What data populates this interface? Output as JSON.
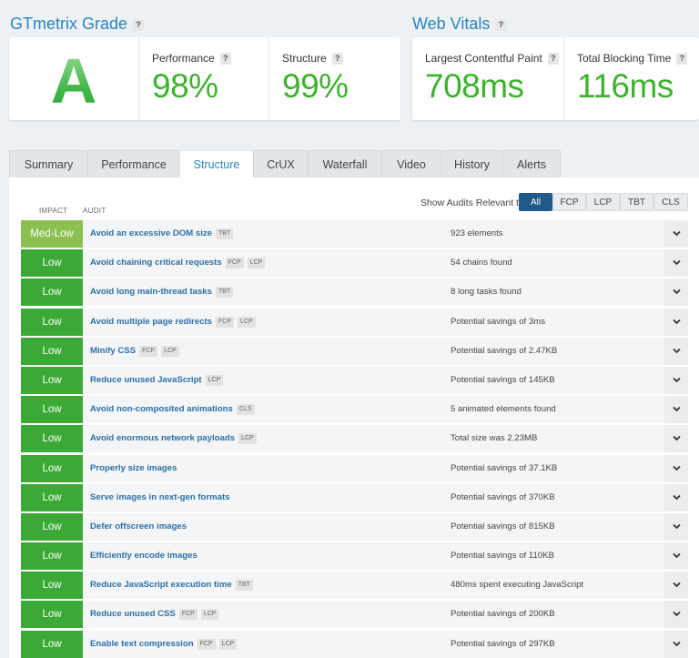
{
  "grade_section": {
    "title": "GTmetrix Grade",
    "help": "?",
    "grade": "A",
    "metrics": [
      {
        "label": "Performance",
        "value": "98%"
      },
      {
        "label": "Structure",
        "value": "99%"
      }
    ]
  },
  "vitals_section": {
    "title": "Web Vitals",
    "help": "?",
    "metrics": [
      {
        "label": "Largest Contentful Paint",
        "value": "708ms"
      },
      {
        "label": "Total Blocking Time",
        "value": "116ms"
      }
    ]
  },
  "tabs": [
    "Summary",
    "Performance",
    "Structure",
    "CrUX",
    "Waterfall",
    "Video",
    "History",
    "Alerts"
  ],
  "active_tab": "Structure",
  "table": {
    "impact_header": "IMPACT",
    "audit_header": "AUDIT",
    "filter_label": "Show Audits Relevant to",
    "filters": [
      "All",
      "FCP",
      "LCP",
      "TBT",
      "CLS"
    ],
    "active_filter": "All"
  },
  "colors": {
    "med_low": "#8cc152",
    "low": "#3aa935",
    "accent": "#2a84c2",
    "grade": "#4cbc52"
  },
  "audits": [
    {
      "impact": "Med-Low",
      "name": "Avoid an excessive DOM size",
      "tags": [
        "TBT"
      ],
      "result": "923 elements"
    },
    {
      "impact": "Low",
      "name": "Avoid chaining critical requests",
      "tags": [
        "FCP",
        "LCP"
      ],
      "result": "54 chains found"
    },
    {
      "impact": "Low",
      "name": "Avoid long main-thread tasks",
      "tags": [
        "TBT"
      ],
      "result": "8 long tasks found"
    },
    {
      "impact": "Low",
      "name": "Avoid multiple page redirects",
      "tags": [
        "FCP",
        "LCP"
      ],
      "result": "Potential savings of 3ms"
    },
    {
      "impact": "Low",
      "name": "Minify CSS",
      "tags": [
        "FCP",
        "LCP"
      ],
      "result": "Potential savings of 2.47KB"
    },
    {
      "impact": "Low",
      "name": "Reduce unused JavaScript",
      "tags": [
        "LCP"
      ],
      "result": "Potential savings of 145KB"
    },
    {
      "impact": "Low",
      "name": "Avoid non-composited animations",
      "tags": [
        "CLS"
      ],
      "result": "5 animated elements found"
    },
    {
      "impact": "Low",
      "name": "Avoid enormous network payloads",
      "tags": [
        "LCP"
      ],
      "result": "Total size was 2.23MB"
    },
    {
      "impact": "Low",
      "name": "Properly size images",
      "tags": [],
      "result": "Potential savings of 37.1KB"
    },
    {
      "impact": "Low",
      "name": "Serve images in next-gen formats",
      "tags": [],
      "result": "Potential savings of 370KB"
    },
    {
      "impact": "Low",
      "name": "Defer offscreen images",
      "tags": [],
      "result": "Potential savings of 815KB"
    },
    {
      "impact": "Low",
      "name": "Efficiently encode images",
      "tags": [],
      "result": "Potential savings of 110KB"
    },
    {
      "impact": "Low",
      "name": "Reduce JavaScript execution time",
      "tags": [
        "TBT"
      ],
      "result": "480ms spent executing JavaScript"
    },
    {
      "impact": "Low",
      "name": "Reduce unused CSS",
      "tags": [
        "FCP",
        "LCP"
      ],
      "result": "Potential savings of 200KB"
    },
    {
      "impact": "Low",
      "name": "Enable text compression",
      "tags": [
        "FCP",
        "LCP"
      ],
      "result": "Potential savings of 297KB"
    }
  ]
}
